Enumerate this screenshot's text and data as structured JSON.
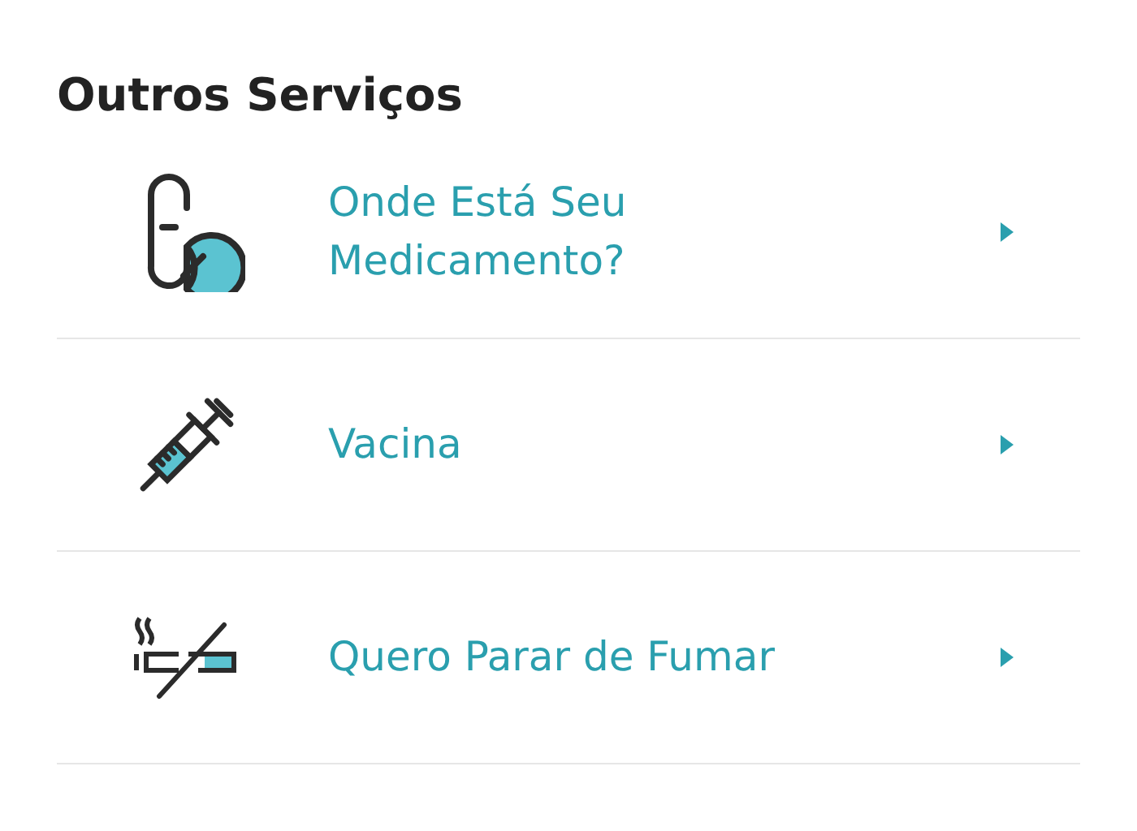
{
  "title": "Outros Serviços",
  "items": [
    {
      "kind": "pill",
      "label": "Onde Está Seu\nMedicamento?"
    },
    {
      "kind": "syringe",
      "label": "Vacina"
    },
    {
      "kind": "no-smoking",
      "label": "Quero Parar de Fumar"
    }
  ]
}
